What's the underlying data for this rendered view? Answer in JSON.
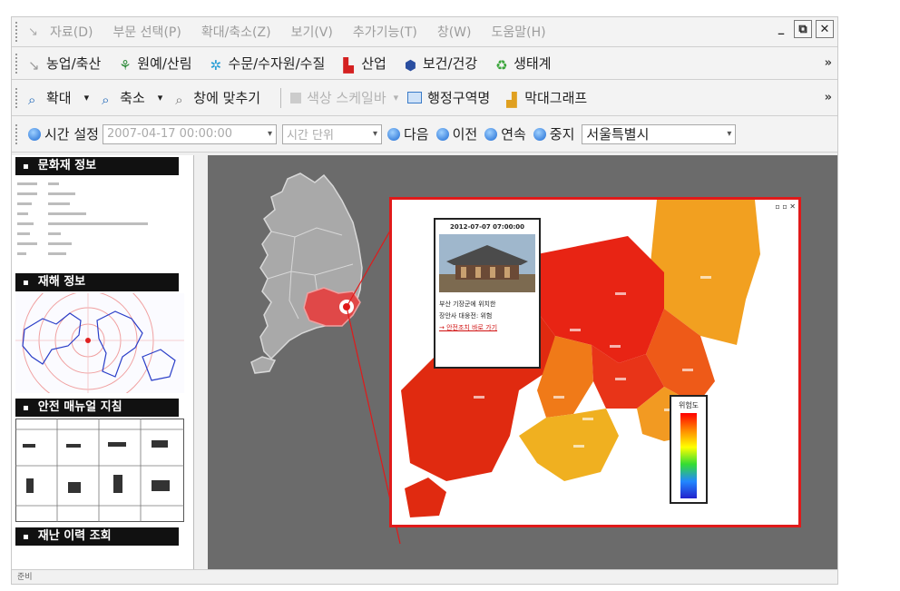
{
  "menu": {
    "items": [
      "자료(D)",
      "부문 선택(P)",
      "확대/축소(Z)",
      "보기(V)",
      "추가기능(T)",
      "창(W)",
      "도움말(H)"
    ],
    "window_buttons": [
      "_",
      "⧉",
      "✕"
    ]
  },
  "sectors": {
    "items": [
      {
        "label": "농업/축산",
        "color": "#9a9a9a"
      },
      {
        "label": "원예/산림",
        "color": "#2e8b3a"
      },
      {
        "label": "수문/수자원/수질",
        "color": "#2a9fd6"
      },
      {
        "label": "산업",
        "color": "#d42020"
      },
      {
        "label": "보건/건강",
        "color": "#2a4ea0"
      },
      {
        "label": "생태계",
        "color": "#3aa53a"
      }
    ],
    "overflow": "»"
  },
  "zoom_toolbar": {
    "zoom_in": "확대",
    "zoom_out": "축소",
    "fit": "창에 맞추기",
    "color_scale": "색상 스케일바",
    "admin_name": "행정구역명",
    "bar_graph": "막대그래프",
    "overflow": "»"
  },
  "time_toolbar": {
    "time_setting": "시간 설정",
    "datetime_value": "2007-04-17 00:00:00",
    "time_unit_placeholder": "시간 단위",
    "next": "다음",
    "prev": "이전",
    "continuous": "연속",
    "stop": "중지",
    "region": "서울특별시"
  },
  "left_panel": {
    "sections": [
      "문화재 정보",
      "재해 정보",
      "안전 매뉴얼 지침",
      "재난 이력 조회"
    ]
  },
  "popup": {
    "timestamp": "2012-07-07 07:00:00",
    "message_line1": "부산 기장군에 위치한",
    "message_line2": "장안사 대웅전: 위험",
    "link": "→ 안전조치 바로 가기"
  },
  "legend": {
    "title": "위험도"
  },
  "status": "준비",
  "colors": {
    "highlight": "#e01a1a",
    "map_bg": "#6b6b6b"
  }
}
